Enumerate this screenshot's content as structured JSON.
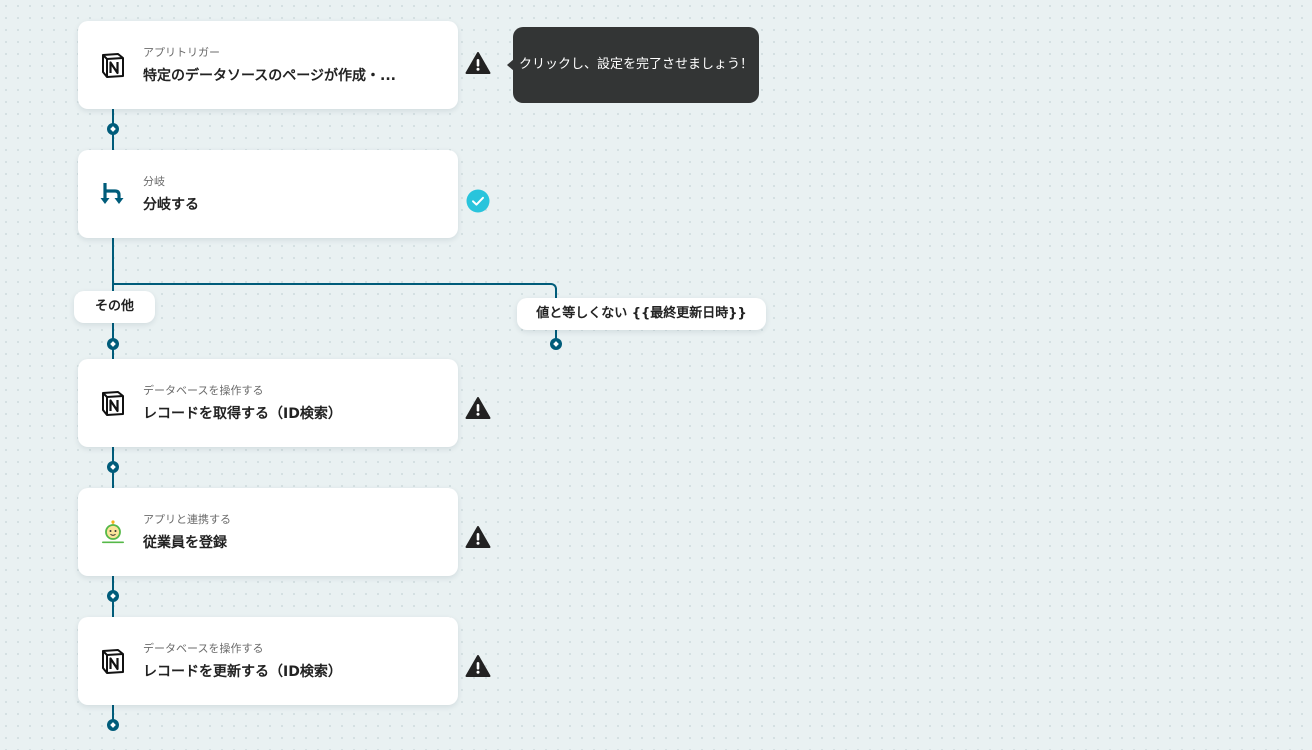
{
  "tooltip": {
    "text": "クリックし、設定を完了させましょう！"
  },
  "steps": [
    {
      "meta": "アプリトリガー",
      "title": "特定のデータソースのページが作成・...",
      "app_icon": "notion-icon",
      "status": "warning"
    },
    {
      "meta": "分岐",
      "title": "分岐する",
      "app_icon": "branch-icon",
      "status": "complete"
    },
    {
      "meta": "データベースを操作する",
      "title": "レコードを取得する（ID検索）",
      "app_icon": "notion-icon",
      "status": "warning"
    },
    {
      "meta": "アプリと連携する",
      "title": "従業員を登録",
      "app_icon": "hr-app-icon",
      "status": "warning"
    },
    {
      "meta": "データベースを操作する",
      "title": "レコードを更新する（ID検索）",
      "app_icon": "notion-icon",
      "status": "warning"
    }
  ],
  "branches": {
    "left_label": "その他",
    "right_label": "値と等しくない {{最終更新日時}}"
  },
  "colors": {
    "connector": "#005c7a",
    "warning": "#222222",
    "complete": "#29c4dc",
    "tooltip_bg": "#333535",
    "canvas_bg": "#e9f1f2"
  }
}
